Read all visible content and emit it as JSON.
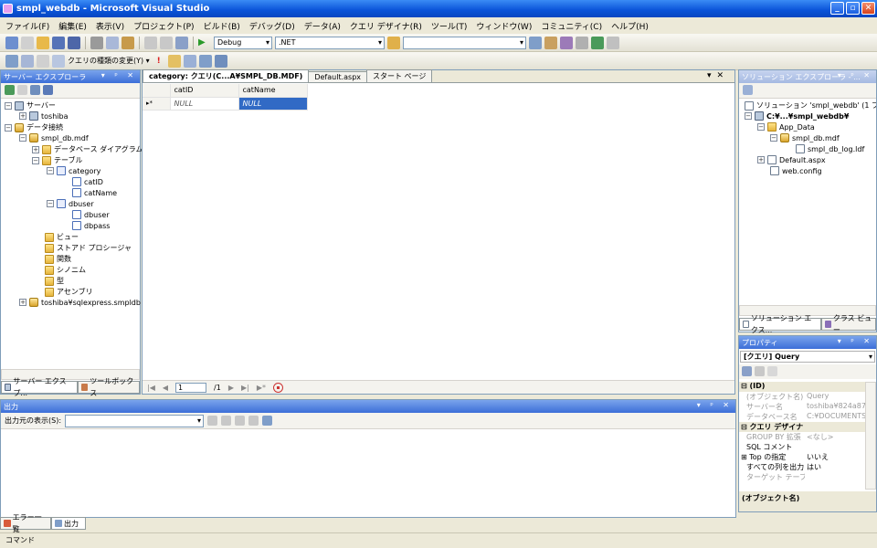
{
  "window": {
    "title": "smpl_webdb - Microsoft Visual Studio",
    "min": "_",
    "max": "▫",
    "close": "✕"
  },
  "menu": [
    "ファイル(F)",
    "編集(E)",
    "表示(V)",
    "プロジェクト(P)",
    "ビルド(B)",
    "デバッグ(D)",
    "データ(A)",
    "クエリ デザイナ(R)",
    "ツール(T)",
    "ウィンドウ(W)",
    "コミュニティ(C)",
    "ヘルプ(H)"
  ],
  "toolbar": {
    "config": "Debug",
    "platform": ".NET",
    "query_type_label": "クエリの種類の変更(Y) ▾"
  },
  "server_explorer": {
    "title": "サーバー エクスプローラ",
    "nodes": [
      "サーバー",
      "toshiba",
      "データ接続",
      "smpl_db.mdf",
      "データベース ダイアグラム",
      "テーブル",
      "category",
      "catID",
      "catName",
      "dbuser",
      "dbuser",
      "dbpass",
      "ビュー",
      "ストアド プロシージャ",
      "関数",
      "シノニム",
      "型",
      "アセンブリ",
      "toshiba¥sqlexpress.smpldb"
    ],
    "tabs": [
      "サーバー エクスプ...",
      "ツールボックス"
    ]
  },
  "editor": {
    "tabs": [
      "category: クエリ(C...A¥SMPL_DB.MDF)",
      "Default.aspx",
      "スタート ページ"
    ],
    "columns": [
      "catID",
      "catName"
    ],
    "row": {
      "marker": "▸*",
      "catID": "NULL",
      "catName": "NULL"
    },
    "nav": {
      "page": "1",
      "of": "/1"
    }
  },
  "output": {
    "title": "出力",
    "source_label": "出力元の表示(S):",
    "tabs": [
      "エラー一覧",
      "出力"
    ]
  },
  "solution": {
    "title": "ソリューション エクスプローラ - ...",
    "nodes": [
      "ソリューション 'smpl_webdb' (1 プロジ",
      "C:¥...¥smpl_webdb¥",
      "App_Data",
      "smpl_db.mdf",
      "smpl_db_log.ldf",
      "Default.aspx",
      "web.config"
    ],
    "tabs": [
      "ソリューション エクス...",
      "クラス ビュー"
    ]
  },
  "properties": {
    "title": "プロパティ",
    "object": "[クエリ] Query",
    "rows": [
      {
        "k": "⊟ (ID)",
        "v": "",
        "cat": true
      },
      {
        "k": "(オブジェクト名)",
        "v": "Query",
        "gray": true
      },
      {
        "k": "サーバー名",
        "v": "toshiba¥824a875",
        "gray": true
      },
      {
        "k": "データベース名",
        "v": "C:¥DOCUMENTS",
        "gray": true
      },
      {
        "k": "⊟ クエリ デザイナ",
        "v": "",
        "cat": true
      },
      {
        "k": "GROUP BY 拡張",
        "v": "<なし>",
        "gray": true
      },
      {
        "k": "SQL コメント",
        "v": ""
      },
      {
        "k": "⊞ Top の指定",
        "v": "いいえ"
      },
      {
        "k": "すべての列を出力",
        "v": "はい"
      },
      {
        "k": "ターゲット テーブル",
        "v": "",
        "gray": true
      }
    ],
    "desc": "(オブジェクト名)"
  },
  "status": "コマンド"
}
